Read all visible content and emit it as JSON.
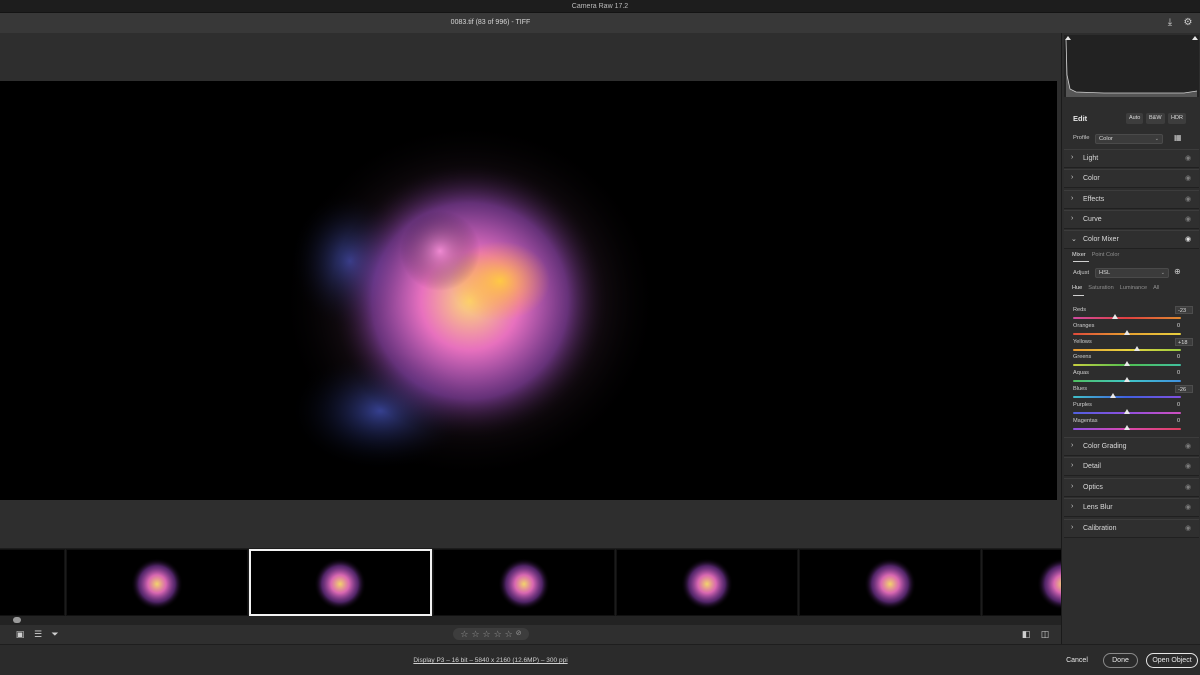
{
  "window": {
    "title": "Camera Raw 17.2"
  },
  "document": {
    "title": "0083.tif (83 of 996)  -  TIFF"
  },
  "filmstrip": {
    "selected_index": 1,
    "thumbnail_count": 6
  },
  "footer": {
    "info": "Display P3 – 16 bit – 5840 x 2160 (12.6MP) – 300 ppi",
    "cancel": "Cancel",
    "done": "Done",
    "open_object": "Open Object"
  },
  "edit": {
    "title": "Edit",
    "auto": "Auto",
    "bw": "B&W",
    "hdr": "HDR",
    "profile_label": "Profile",
    "profile_value": "Color"
  },
  "sections_top": [
    "Light",
    "Color",
    "Effects",
    "Curve"
  ],
  "color_mixer": {
    "title": "Color Mixer",
    "tabs": [
      "Mixer",
      "Point Color"
    ],
    "adjust_label": "Adjust",
    "adjust_value": "HSL",
    "subtabs": [
      "Hue",
      "Saturation",
      "Luminance",
      "All"
    ],
    "sliders": [
      {
        "label": "Reds",
        "value": "-23",
        "n": -23,
        "boxed": true,
        "gradient": "linear-gradient(90deg,#d04aa0,#e04040,#e08a30)"
      },
      {
        "label": "Oranges",
        "value": "0",
        "n": 0,
        "boxed": false,
        "gradient": "linear-gradient(90deg,#e04a3a,#e8a030,#e8d040)"
      },
      {
        "label": "Yellows",
        "value": "+18",
        "n": 18,
        "boxed": true,
        "gradient": "linear-gradient(90deg,#e89a30,#e8d440,#9ed040)"
      },
      {
        "label": "Greens",
        "value": "0",
        "n": 0,
        "boxed": false,
        "gradient": "linear-gradient(90deg,#c8d040,#50c050,#40c0a0)"
      },
      {
        "label": "Aquas",
        "value": "0",
        "n": 0,
        "boxed": false,
        "gradient": "linear-gradient(90deg,#50c060,#40c8c8,#4090e0)"
      },
      {
        "label": "Blues",
        "value": "-26",
        "n": -26,
        "boxed": true,
        "gradient": "linear-gradient(90deg,#40c0c8,#4060e0,#8050e0)"
      },
      {
        "label": "Purples",
        "value": "0",
        "n": 0,
        "boxed": false,
        "gradient": "linear-gradient(90deg,#5060e0,#9050e0,#d050c0)"
      },
      {
        "label": "Magentas",
        "value": "0",
        "n": 0,
        "boxed": false,
        "gradient": "linear-gradient(90deg,#9050e0,#d848b0,#e04060)"
      }
    ]
  },
  "sections_bottom": [
    "Color Grading",
    "Detail",
    "Optics",
    "Lens Blur",
    "Calibration"
  ]
}
